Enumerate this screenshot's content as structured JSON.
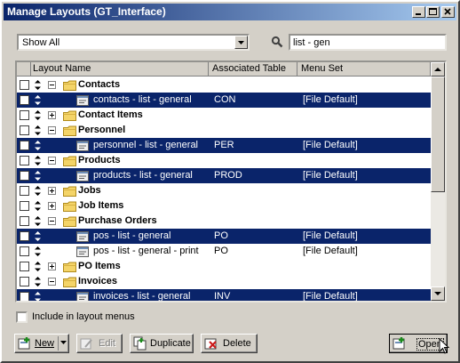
{
  "window": {
    "title": "Manage Layouts (GT_Interface)"
  },
  "filter": {
    "selected": "Show All"
  },
  "search": {
    "value": "list - gen"
  },
  "columns": [
    "Layout Name",
    "Associated Table",
    "Menu Set"
  ],
  "rows": [
    {
      "kind": "group",
      "name": "Contacts",
      "expanded": true
    },
    {
      "kind": "layout",
      "name": "contacts - list - general",
      "table": "CON",
      "menu": "[File Default]",
      "selected": true
    },
    {
      "kind": "group",
      "name": "Contact Items",
      "expanded": false
    },
    {
      "kind": "group",
      "name": "Personnel",
      "expanded": true
    },
    {
      "kind": "layout",
      "name": "personnel - list - general",
      "table": "PER",
      "menu": "[File Default]",
      "selected": true
    },
    {
      "kind": "group",
      "name": "Products",
      "expanded": true
    },
    {
      "kind": "layout",
      "name": "products - list - general",
      "table": "PROD",
      "menu": "[File Default]",
      "selected": true
    },
    {
      "kind": "group",
      "name": "Jobs",
      "expanded": false
    },
    {
      "kind": "group",
      "name": "Job Items",
      "expanded": false
    },
    {
      "kind": "group",
      "name": "Purchase Orders",
      "expanded": true
    },
    {
      "kind": "layout",
      "name": "pos - list - general",
      "table": "PO",
      "menu": "[File Default]",
      "selected": true
    },
    {
      "kind": "layout",
      "name": "pos - list - general - print",
      "table": "PO",
      "menu": "[File Default]",
      "selected": false
    },
    {
      "kind": "group",
      "name": "PO Items",
      "expanded": false
    },
    {
      "kind": "group",
      "name": "Invoices",
      "expanded": true
    },
    {
      "kind": "layout",
      "name": "invoices - list - general",
      "table": "INV",
      "menu": "[File Default]",
      "selected": true
    }
  ],
  "include_label": "Include in layout menus",
  "buttons": {
    "new": "New",
    "edit": "Edit",
    "duplicate": "Duplicate",
    "delete": "Delete",
    "open": "Open"
  },
  "colors": {
    "selection": "#0a246a",
    "face": "#d4d0c8",
    "folder": "#f4d468"
  }
}
